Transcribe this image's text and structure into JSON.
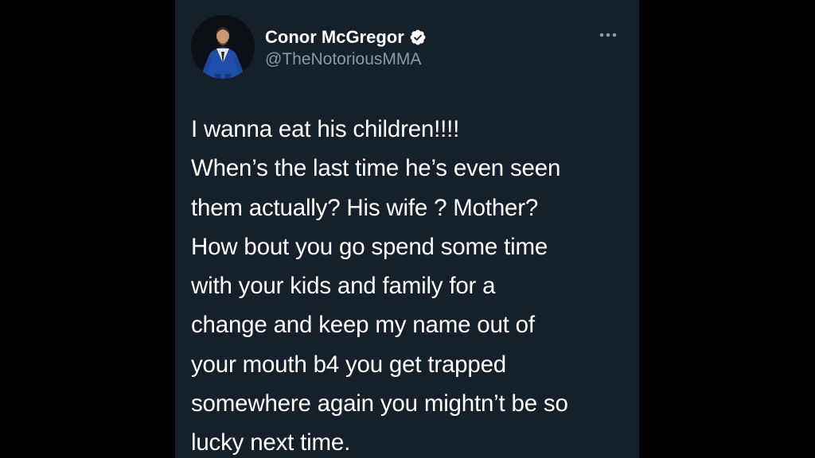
{
  "tweet": {
    "author": {
      "display_name": "Conor McGregor",
      "handle": "@TheNotoriousMMA",
      "verified": true,
      "verified_color": "#ffffff",
      "avatar_alt": "profile photo, man in blue suit"
    },
    "more_icon": "more-horizontal-icon",
    "lines": [
      "I wanna eat his children!!!!",
      "When’s the last time he’s even seen",
      "them actually? His wife ? Mother?",
      "How bout you go spend some time",
      "with your kids and family for a",
      "change and keep my name out of",
      "your mouth b4 you get trapped",
      "somewhere again you mightn’t be so",
      "lucky next time."
    ]
  },
  "theme": {
    "page_background": "#000000",
    "card_background": "#15202b",
    "text_primary": "#ffffff",
    "text_secondary": "#8b98a5"
  }
}
